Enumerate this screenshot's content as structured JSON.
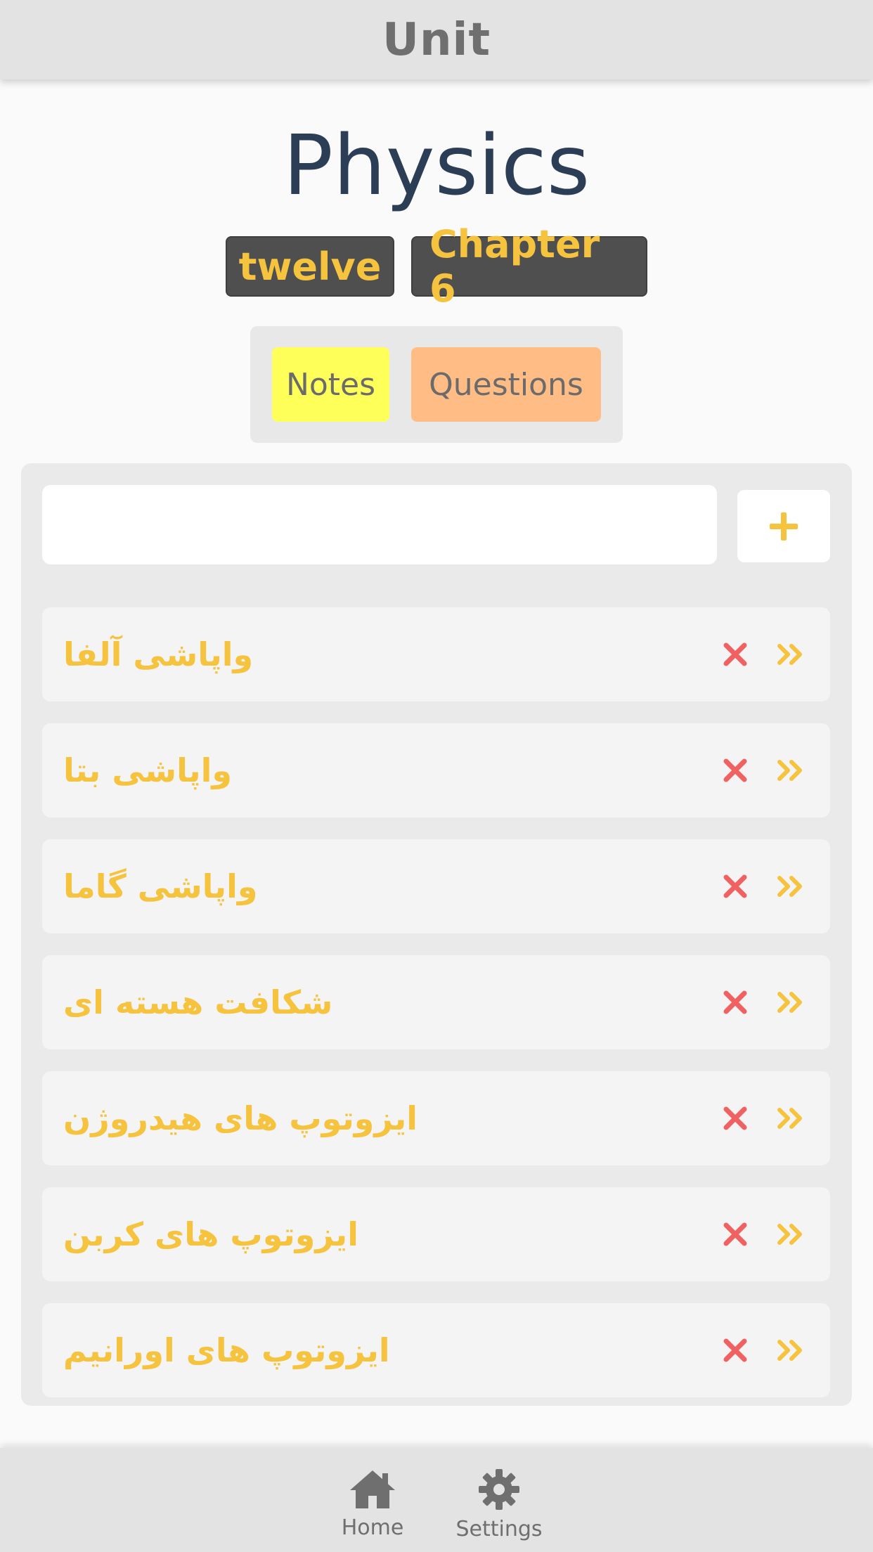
{
  "header": {
    "title": "Unit"
  },
  "subject": {
    "title": "Physics",
    "grade": "twelve",
    "chapter": "Chapter 6"
  },
  "tabs": [
    {
      "label": "Notes",
      "color": "#ffff5a"
    },
    {
      "label": "Questions",
      "color": "#ffbd85"
    }
  ],
  "new_item": {
    "value": "",
    "placeholder": "",
    "add_icon": "plus-icon"
  },
  "items": [
    {
      "title": "واپاشی آلفا"
    },
    {
      "title": "واپاشی بتا"
    },
    {
      "title": "واپاشی گاما"
    },
    {
      "title": "شکافت هسته ای"
    },
    {
      "title": "ایزوتوپ های هیدروژن"
    },
    {
      "title": "ایزوتوپ های کربن"
    },
    {
      "title": "ایزوتوپ های اورانیم"
    }
  ],
  "item_actions": {
    "delete_icon": "close-icon",
    "open_icon": "double-chevron-right-icon"
  },
  "nav": [
    {
      "label": "Home",
      "icon": "home-icon"
    },
    {
      "label": "Settings",
      "icon": "gear-icon"
    }
  ],
  "colors": {
    "accent": "#f6c33f",
    "delete": "#f06262",
    "title": "#2c3e56",
    "badge_bg": "#4f4f4f"
  }
}
